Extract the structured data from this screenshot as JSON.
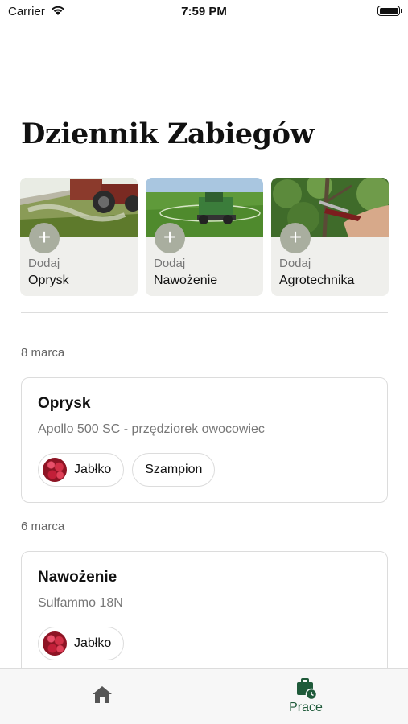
{
  "status_bar": {
    "carrier": "Carrier",
    "time": "7:59 PM"
  },
  "page_title": "Dziennik Zabiegów",
  "add_cards": [
    {
      "small": "Dodaj",
      "main": "Oprysk",
      "icon": "plus-icon"
    },
    {
      "small": "Dodaj",
      "main": "Nawożenie",
      "icon": "plus-icon"
    },
    {
      "small": "Dodaj",
      "main": "Agrotechnika",
      "icon": "plus-icon"
    }
  ],
  "add_plus_symbol": "+",
  "entries": [
    {
      "date": "8 marca",
      "title": "Oprysk",
      "subtitle": "Apollo 500 SC - przędziorek owocowiec",
      "chips": [
        "Jabłko",
        "Szampion"
      ]
    },
    {
      "date": "6 marca",
      "title": "Nawożenie",
      "subtitle": "Sulfammo 18N",
      "chips": [
        "Jabłko"
      ]
    }
  ],
  "tab_bar": {
    "home_icon": "home-icon",
    "prace_icon": "briefcase-clock-icon",
    "prace_label": "Prace",
    "active_color": "#1f5a3a",
    "inactive_color": "#555555"
  },
  "colors": {
    "plus_bg": "#a9ae9f",
    "card_bg": "#efefec",
    "accent": "#1f5a3a"
  }
}
